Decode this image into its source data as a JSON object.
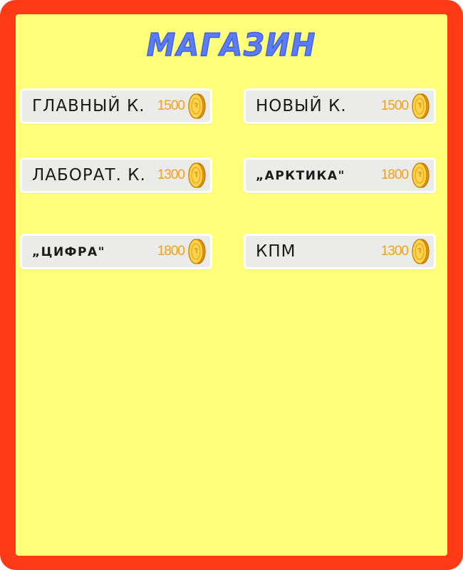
{
  "shop": {
    "title": "МАГАЗИН",
    "items": [
      {
        "name": "ГЛАВНЫЙ К.",
        "price": "1500",
        "icon": "coin-icon"
      },
      {
        "name": "НОВЫЙ К.",
        "price": "1500",
        "icon": "coin-icon"
      },
      {
        "name": "ЛАБОРАТ. К.",
        "price": "1300",
        "icon": "coin-icon"
      },
      {
        "name": "„АРКТИКА\"",
        "price": "1800",
        "icon": "coin-icon"
      },
      {
        "name": "„ЦИФРА\"",
        "price": "1800",
        "icon": "coin-icon"
      },
      {
        "name": "КПМ",
        "price": "1300",
        "icon": "coin-icon"
      }
    ]
  },
  "colors": {
    "frame": "#ff3a17",
    "panel": "#ffff7a",
    "title": "#5b7cf5",
    "price": "#f2a21c",
    "item_bg": "#ebebea"
  }
}
